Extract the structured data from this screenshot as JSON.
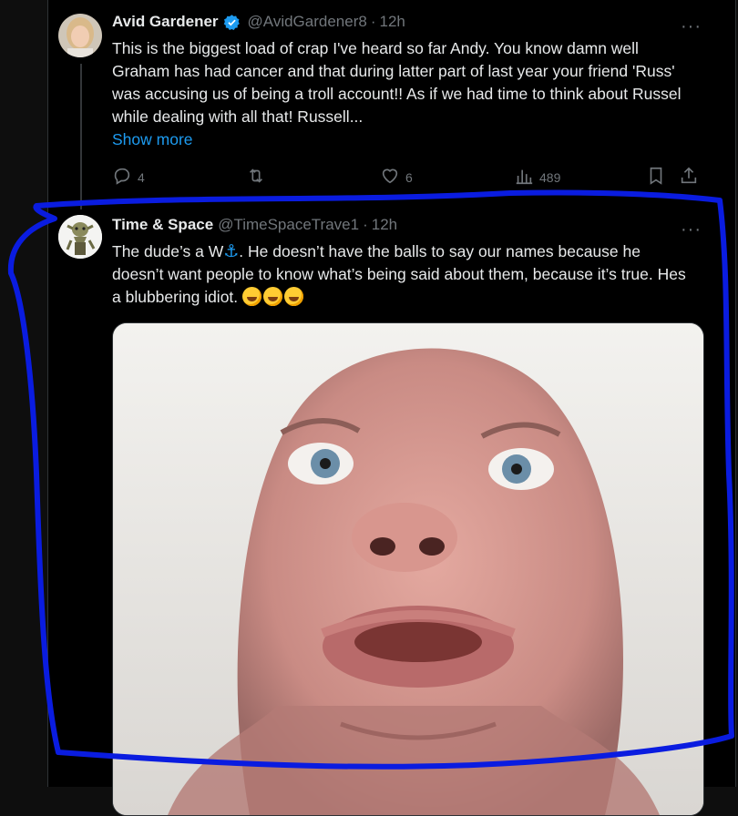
{
  "tweet1": {
    "name": "Avid Gardener",
    "handle": "@AvidGardener8",
    "separator": "·",
    "time": "12h",
    "more": "···",
    "text": "This is the biggest load of crap I've heard so far Andy. You know damn well Graham has had cancer and that during latter part of last year your friend 'Russ' was accusing us of being a troll account!! As if we had time to think about Russel while dealing with all that!  Russell...",
    "show_more": "Show more",
    "replies": "4",
    "reposts": "",
    "likes": "6",
    "views": "489"
  },
  "tweet2": {
    "name": "Time & Space",
    "handle": "@TimeSpaceTrave1",
    "separator": "·",
    "time": "12h",
    "more": "···",
    "text_part1": "The dude’s a W",
    "anchor": "⚓",
    "text_part2": ". He doesn’t have the balls to say our names because he doesn’t want people to know what’s being said about them, because it’s true. Hes a blubbering idiot. "
  },
  "icons": {
    "verified": "verified-badge-icon",
    "reply": "reply-icon",
    "repost": "repost-icon",
    "like": "heart-icon",
    "views": "views-icon",
    "bookmark": "bookmark-icon",
    "share": "share-icon"
  },
  "colors": {
    "background": "#000000",
    "text": "#e7e9ea",
    "muted": "#71767b",
    "link": "#1d9bf0",
    "annotation": "#0a1ce0"
  }
}
